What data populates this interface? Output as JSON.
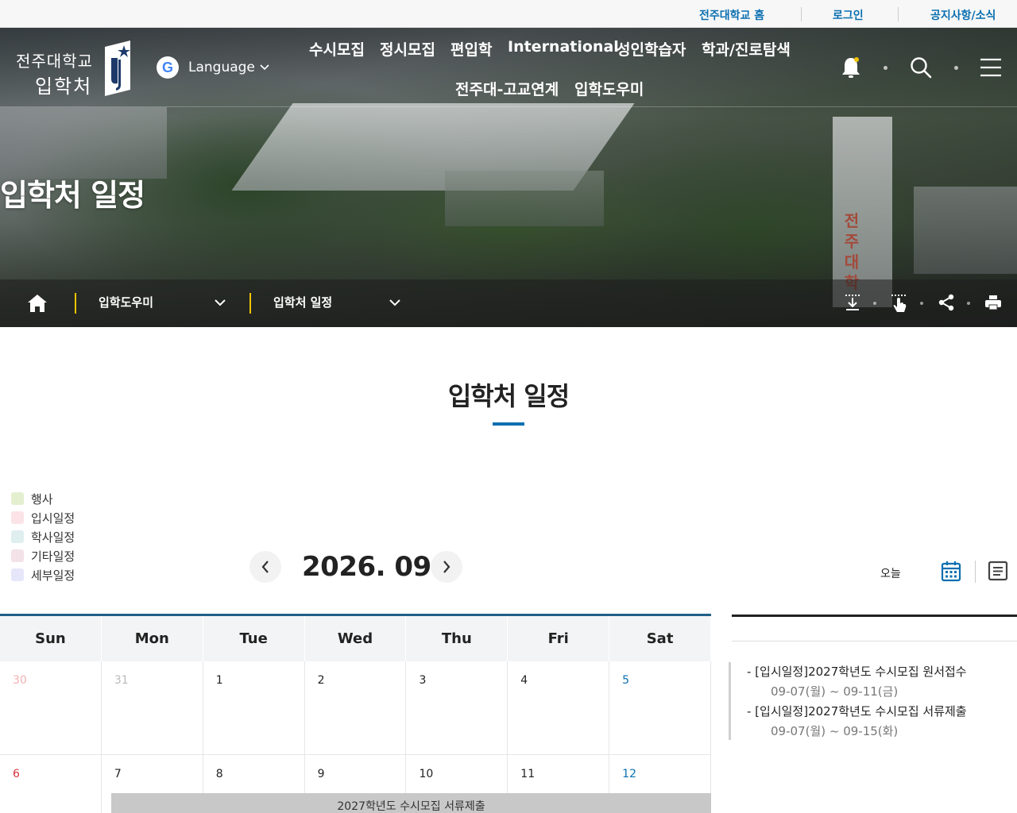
{
  "util": {
    "home_link": "전주대학교 홈",
    "login_link": "로그인",
    "notice_link": "공지사항/소식"
  },
  "logo": {
    "line1": "전주대학교",
    "line2": "입학처"
  },
  "language": {
    "label": "Language"
  },
  "menu": {
    "items": [
      "수시모집",
      "정시모집",
      "편입학",
      "International",
      "성인학습자",
      "학과/진로탐색",
      "전주대-고교연계",
      "입학도우미"
    ]
  },
  "hero": {
    "heading": "입학처 일정",
    "tower_text": "전주대학"
  },
  "breadcrumb": {
    "level1": "입학도우미",
    "level2": "입학처 일정"
  },
  "page": {
    "title": "입학처 일정"
  },
  "legend": [
    {
      "label": "행사",
      "color": "#e4efcf"
    },
    {
      "label": "입시일정",
      "color": "#fbe3e8"
    },
    {
      "label": "학사일정",
      "color": "#dfeeee"
    },
    {
      "label": "기타일정",
      "color": "#f3e2e8"
    },
    {
      "label": "세부일정",
      "color": "#e6e6fb"
    }
  ],
  "calendar": {
    "month_label": "2026. 09",
    "today_label": "오늘",
    "weekdays": [
      "Sun",
      "Mon",
      "Tue",
      "Wed",
      "Thu",
      "Fri",
      "Sat"
    ],
    "week1": [
      "30",
      "31",
      "1",
      "2",
      "3",
      "4",
      "5"
    ],
    "week2": [
      "6",
      "7",
      "8",
      "9",
      "10",
      "11",
      "12"
    ],
    "event_bar": "2027학년도 수시모집 서류제출"
  },
  "events": [
    {
      "title": "- [입시일정]2027학년도 수시모집 원서접수",
      "date": "09-07(월) ~ 09-11(금)"
    },
    {
      "title": "- [입시일정]2027학년도 수시모집 서류제출",
      "date": "09-07(월) ~ 09-15(화)"
    }
  ],
  "colors": {
    "accent": "#0a6fb0",
    "breadcrumb_divider": "#f4c400",
    "sunday": "#d9363e"
  }
}
